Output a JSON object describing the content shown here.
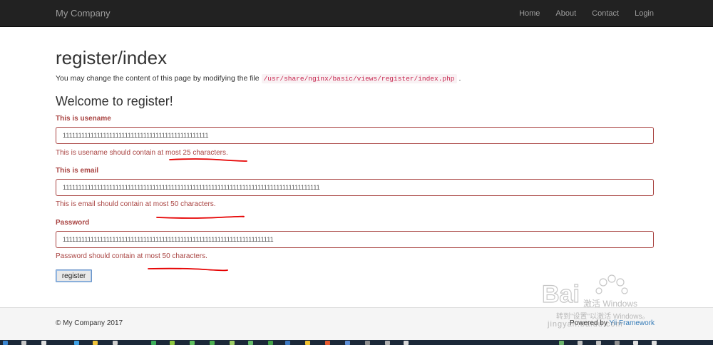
{
  "navbar": {
    "brand": "My Company",
    "items": [
      {
        "label": "Home"
      },
      {
        "label": "About"
      },
      {
        "label": "Contact"
      },
      {
        "label": "Login"
      }
    ]
  },
  "page": {
    "title": "register/index",
    "intro_text": "You may change the content of this page by modifying the file",
    "intro_code": "/usr/share/nginx/basic/views/register/index.php",
    "intro_end": "."
  },
  "form": {
    "heading": "Welcome to register!",
    "username": {
      "label": "This is usename",
      "value": "11111111111111111111111111111111111111111111111",
      "error": "This is usename should contain at most 25 characters."
    },
    "email": {
      "label": "This is email",
      "value": "11111111111111111111111111111111111111111111111111111111111111111111111111111111111",
      "error": "This is email should contain at most 50 characters."
    },
    "password": {
      "label": "Password",
      "value": "11111111111111111111111111111111111111111111111111111111111111111111",
      "error": "Password should contain at most 50 characters."
    },
    "submit_label": "register"
  },
  "footer": {
    "copyright": "© My Company 2017",
    "powered_prefix": "Powered by",
    "powered_link": "Yii Framework"
  },
  "watermark": {
    "activate_title": "激活 Windows",
    "activate_sub": "转到\"设置\"以激活 Windows。",
    "logo": "Baidu经验",
    "url": "jingyan.baidu.com"
  },
  "colors": {
    "navbar_bg": "#222222",
    "error": "#a94442",
    "annotation": "#e60000",
    "link": "#337ab7"
  }
}
